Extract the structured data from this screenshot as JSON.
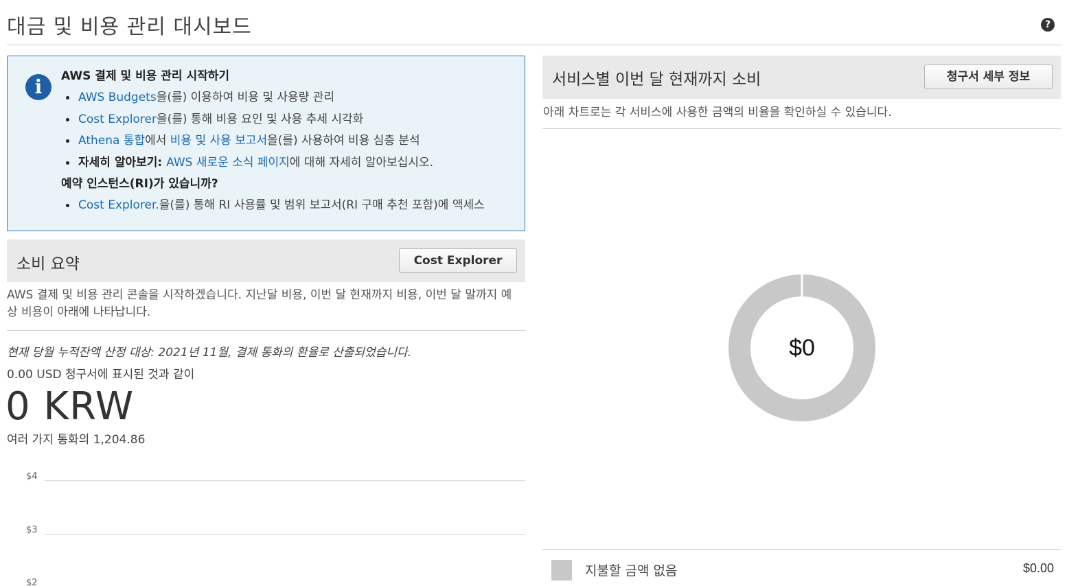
{
  "page": {
    "title": "대금 및 비용 관리 대시보드",
    "help_icon": "question-circle-icon",
    "help_glyph": "?"
  },
  "info_box": {
    "icon": "info-circle-icon",
    "icon_glyph": "i",
    "heading": "AWS 결제 및 비용 관리 시작하기",
    "items": [
      {
        "link": "AWS Budgets",
        "text": "을(를) 이용하여 비용 및 사용량 관리"
      },
      {
        "link": "Cost Explorer",
        "text": "을(를) 통해 비용 요인 및 사용 추세 시각화"
      },
      {
        "link": "Athena 통합",
        "text_mid": "에서 ",
        "link2": "비용 및 사용 보고서",
        "text": "을(를) 사용하여 비용 심층 분석"
      },
      {
        "bold": "자세히 알아보기: ",
        "link": "AWS 새로운 소식 페이지",
        "text": "에 대해 자세히 알아보십시오."
      }
    ],
    "ri_heading": "예약 인스턴스(RI)가 있습니까?",
    "ri_items": [
      {
        "link": "Cost Explorer.",
        "text": "을(를) 통해 RI 사용률 및 범위 보고서(RI 구매 추천 포함)에 액세스"
      }
    ]
  },
  "spend_summary": {
    "title": "소비 요약",
    "button_label": "Cost Explorer",
    "description": "AWS 결제 및 비용 관리 콘솔을 시작하겠습니다. 지난달 비용, 이번 달 현재까지 비용, 이번 달 말까지 예상 비용이 아래에 나타납니다.",
    "accrued_note": "현재 당월 누적잔액 산정 대상: 2021년 11월, 결제 통화의 환율로 산출되었습니다.",
    "usd_line": "0.00 USD 청구서에 표시된 것과 같이",
    "amount": "0 KRW",
    "rate_line": "여러 가지 통화의 1,204.86"
  },
  "spend_chart": {
    "y_ticks": [
      "$4",
      "$3",
      "$2"
    ]
  },
  "service_spend": {
    "title": "서비스별 이번 달 현재까지 소비",
    "button_label": "청구서 세부 정보",
    "description": "아래 차트로는 각 서비스에 사용한 금액의 비율을 확인하실 수 있습니다.",
    "center_label": "$0",
    "ring_color": "#c8c8c8",
    "legend": [
      {
        "label": "지불할 금액 없음",
        "value": "$0.00",
        "color": "#c8c8c8"
      }
    ]
  }
}
